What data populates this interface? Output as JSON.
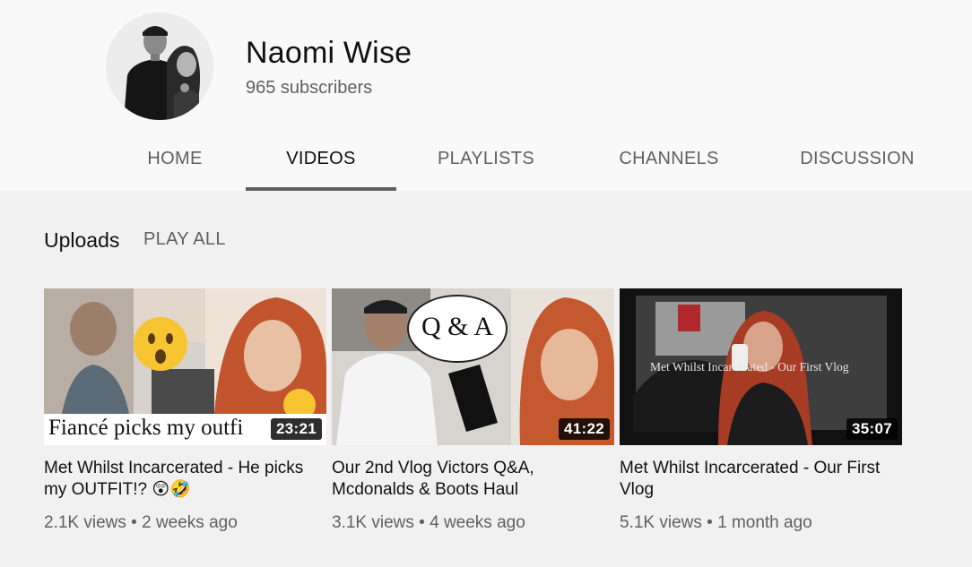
{
  "channel": {
    "name": "Naomi Wise",
    "subscribers": "965 subscribers"
  },
  "tabs": [
    {
      "label": "HOME",
      "active": false
    },
    {
      "label": "VIDEOS",
      "active": true
    },
    {
      "label": "PLAYLISTS",
      "active": false
    },
    {
      "label": "CHANNELS",
      "active": false
    },
    {
      "label": "DISCUSSION",
      "active": false
    }
  ],
  "section": {
    "title": "Uploads",
    "play_all": "PLAY ALL"
  },
  "videos": [
    {
      "title": "Met Whilst Incarcerated - He picks my OUTFIT!? 😲🤣",
      "views": "2.1K views",
      "age": "2 weeks ago",
      "duration": "23:21",
      "thumb_text": "Fiancé picks my outfi"
    },
    {
      "title": "Our 2nd Vlog Victors Q&A, Mcdonalds & Boots Haul",
      "views": "3.1K views",
      "age": "4 weeks ago",
      "duration": "41:22",
      "thumb_text": "Q & A"
    },
    {
      "title": "Met Whilst Incarcerated - Our First Vlog",
      "views": "5.1K views",
      "age": "1 month ago",
      "duration": "35:07",
      "thumb_text": "Met Whilst Incarcerated - Our First Vlog"
    }
  ],
  "separator": "•",
  "colors": {
    "header_bg": "#f9f9f9",
    "page_bg": "#f1f1f1",
    "secondary_text": "#606060",
    "primary_text": "#0f0f0f"
  }
}
